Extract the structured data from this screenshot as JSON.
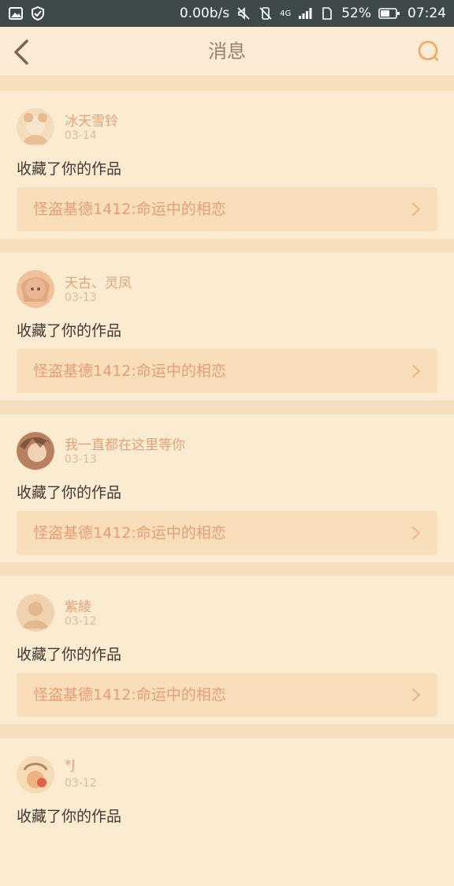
{
  "status": {
    "speed": "0.00b/s",
    "network": "4G",
    "battery": "52%",
    "time": "07:24"
  },
  "header": {
    "title": "消息"
  },
  "messages": [
    {
      "user": "冰天雪铃",
      "date": "03-14",
      "action": "收藏了你的作品",
      "work": "怪盗基德1412:命运中的相恋",
      "avatar_color": "#f2cfa6"
    },
    {
      "user": "天古、灵凤",
      "date": "03-13",
      "action": "收藏了你的作品",
      "work": "怪盗基德1412:命运中的相恋",
      "avatar_color": "#e8b48e"
    },
    {
      "user": "我一直都在这里等你",
      "date": "03-13",
      "action": "收藏了你的作品",
      "work": "怪盗基德1412:命运中的相恋",
      "avatar_color": "#c9906e"
    },
    {
      "user": "紫綾",
      "date": "03-12",
      "action": "收藏了你的作品",
      "work": "怪盗基德1412:命运中的相恋",
      "avatar_color": "#efd3b0"
    },
    {
      "user": "*J",
      "date": "03-12",
      "action": "收藏了你的作品",
      "work": "怪盗基德1412:命运中的相恋",
      "avatar_color": "#f0c9a1"
    }
  ]
}
